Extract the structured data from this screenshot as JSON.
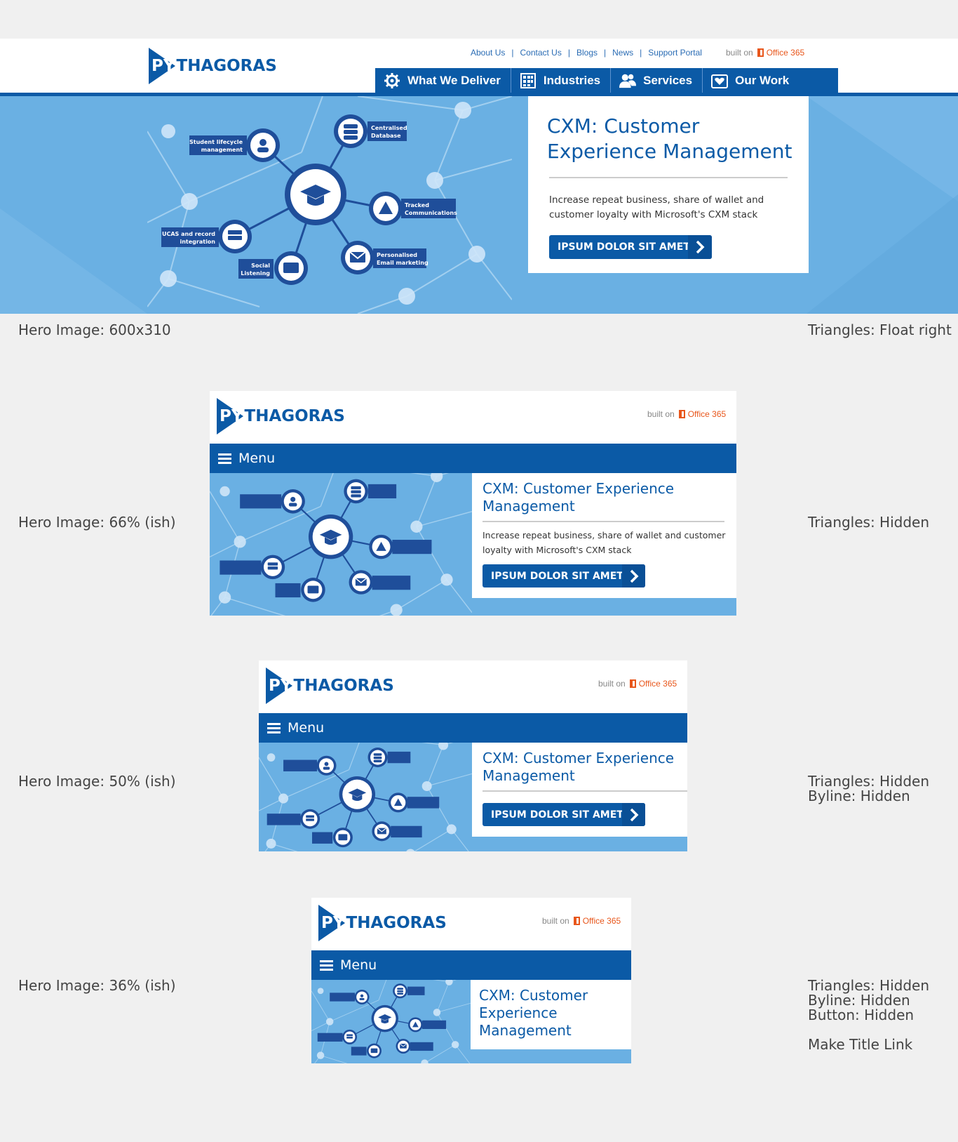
{
  "brand": {
    "logo_prefix": "PY",
    "logo_text": "THAGORAS",
    "built_on": "built on",
    "office": "Office 365"
  },
  "top_links": [
    "About Us",
    "Contact Us",
    "Blogs",
    "News",
    "Support Portal"
  ],
  "nav": [
    {
      "label": "What We Deliver",
      "icon": "gear-icon"
    },
    {
      "label": "Industries",
      "icon": "grid-icon"
    },
    {
      "label": "Services",
      "icon": "people-icon"
    },
    {
      "label": "Our Work",
      "icon": "heart-icon"
    }
  ],
  "menu_label": "Menu",
  "hero": {
    "title": "CXM: Customer Experience Management",
    "title_line1": "CXM: Customer",
    "title_line2": "Experience Management",
    "m_line1": "CXM: Customer Experience",
    "m_line2": "Management",
    "s_line1": "CXM: Customer",
    "s_line2": "Experience",
    "s_line3": "Management",
    "byline_line1": "Increase repeat business, share of wallet and",
    "byline_line2": "customer loyalty with Microsoft's CXM stack",
    "m_byline_line1": "Increase repeat business, share of wallet and customer",
    "m_byline_line2": "loyalty with Microsoft's CXM stack",
    "cta": "IPSUM DOLOR SIT AMET"
  },
  "diagram_labels": {
    "student": [
      "Student lifecycle",
      "management"
    ],
    "database": [
      "Centralised",
      "Database"
    ],
    "tracked": [
      "Tracked",
      "Communications"
    ],
    "ucas": [
      "UCAS and record",
      "integration"
    ],
    "social": [
      "Social",
      "Listening"
    ],
    "email": [
      "Personalised",
      "Email marketing"
    ]
  },
  "notes": {
    "n1_left": "Hero Image: 600x310",
    "n1_right": "Triangles: Float right",
    "n2_left": "Hero Image: 66% (ish)",
    "n2_right": "Triangles: Hidden",
    "n3_left": "Hero Image: 50% (ish)",
    "n3_right_1": "Triangles: Hidden",
    "n3_right_2": "Byline: Hidden",
    "n4_left": "Hero Image: 36% (ish)",
    "n4_right_1": "Triangles: Hidden",
    "n4_right_2": "Byline: Hidden",
    "n4_right_3": "Button: Hidden",
    "n4_right_4": "Make Title Link"
  }
}
